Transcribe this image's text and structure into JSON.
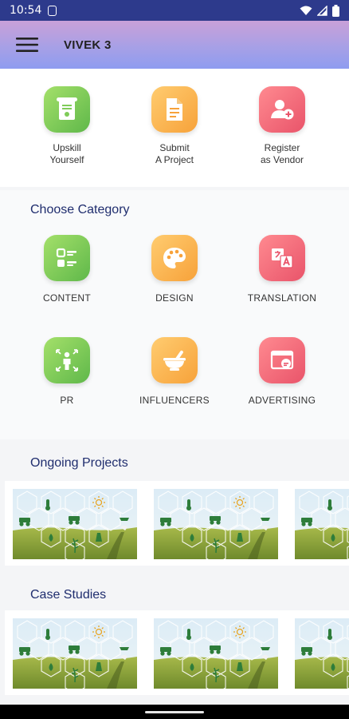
{
  "status_bar": {
    "time": "10:54"
  },
  "app_bar": {
    "title": "VIVEK 3"
  },
  "quick_actions": [
    {
      "label": "Upskill\nYourself",
      "icon": "certificate-icon",
      "color": "green"
    },
    {
      "label": "Submit\nA Project",
      "icon": "document-icon",
      "color": "orange"
    },
    {
      "label": "Register\nas Vendor",
      "icon": "add-user-icon",
      "color": "red"
    }
  ],
  "categories": {
    "title": "Choose Category",
    "items": [
      {
        "label": "CONTENT",
        "icon": "checklist-icon",
        "color": "green"
      },
      {
        "label": "DESIGN",
        "icon": "palette-icon",
        "color": "orange"
      },
      {
        "label": "TRANSLATION",
        "icon": "translate-icon",
        "color": "red"
      },
      {
        "label": "PR",
        "icon": "person-expand-icon",
        "color": "green"
      },
      {
        "label": "INFLUENCERS",
        "icon": "mortar-icon",
        "color": "orange"
      },
      {
        "label": "ADVERTISING",
        "icon": "ad-window-icon",
        "color": "red"
      }
    ]
  },
  "ongoing": {
    "title": "Ongoing Projects",
    "thumbnail_count": 3
  },
  "case_studies": {
    "title": "Case Studies",
    "thumbnail_count": 3
  }
}
